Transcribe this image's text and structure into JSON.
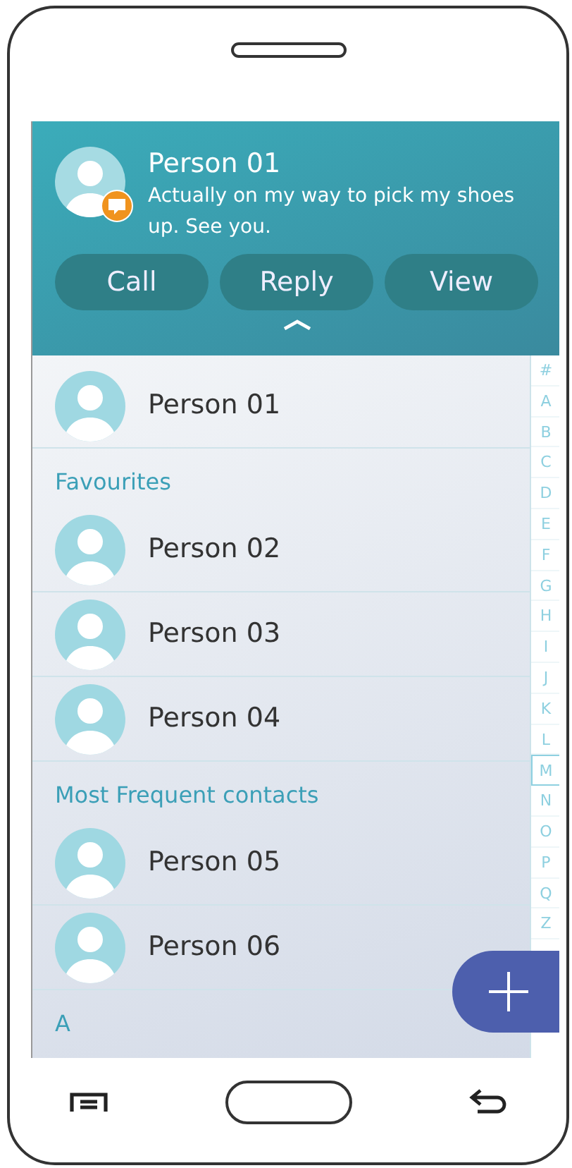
{
  "notification": {
    "name": "Person 01",
    "message": "Actually on my way to pick my shoes up. See you.",
    "actions": [
      "Call",
      "Reply",
      "View"
    ]
  },
  "sections": [
    {
      "contacts": [
        "Person 01"
      ]
    },
    {
      "title": "Favourites",
      "contacts": [
        "Person 02",
        "Person 03",
        "Person 04"
      ]
    },
    {
      "title": "Most Frequent contacts",
      "contacts": [
        "Person 05",
        "Person 06"
      ]
    },
    {
      "title": "A"
    }
  ],
  "index": [
    {
      "letter": "#",
      "selected": false
    },
    {
      "letter": "A",
      "selected": false
    },
    {
      "letter": "B",
      "selected": false
    },
    {
      "letter": "C",
      "selected": false
    },
    {
      "letter": "D",
      "selected": false
    },
    {
      "letter": "E",
      "selected": false
    },
    {
      "letter": "F",
      "selected": false
    },
    {
      "letter": "G",
      "selected": false
    },
    {
      "letter": "H",
      "selected": false
    },
    {
      "letter": "I",
      "selected": false
    },
    {
      "letter": "J",
      "selected": false
    },
    {
      "letter": "K",
      "selected": false
    },
    {
      "letter": "L",
      "selected": false
    },
    {
      "letter": "M",
      "selected": true
    },
    {
      "letter": "N",
      "selected": false
    },
    {
      "letter": "O",
      "selected": false
    },
    {
      "letter": "P",
      "selected": false
    },
    {
      "letter": "Q",
      "selected": false
    },
    {
      "letter": "Z",
      "selected": false
    }
  ]
}
